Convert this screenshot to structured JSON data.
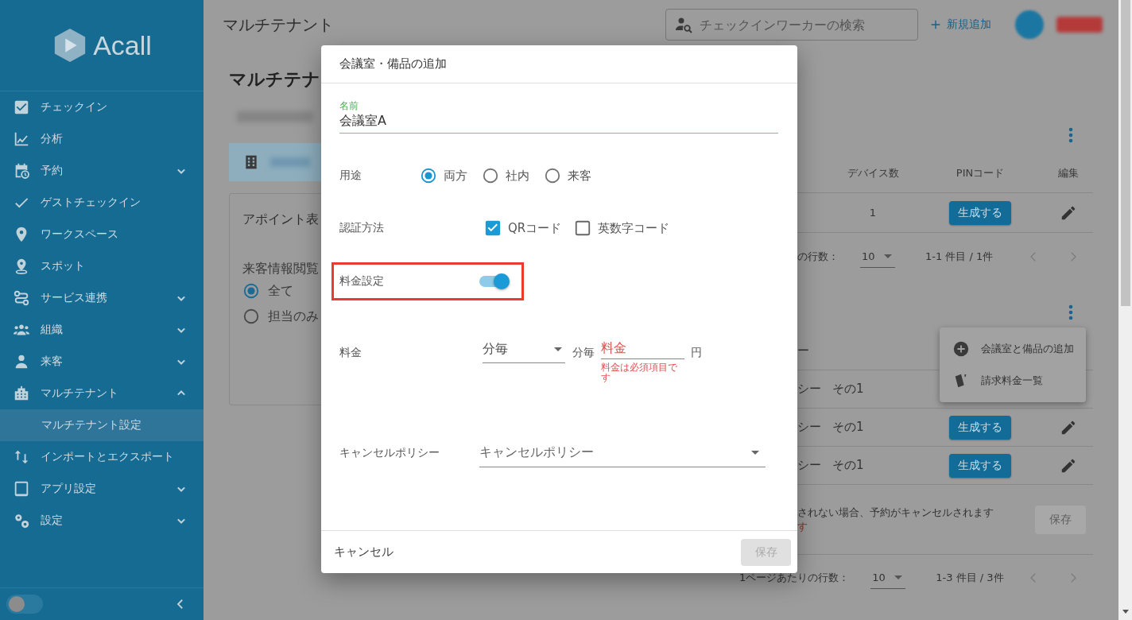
{
  "sidebar": {
    "logo": "Acall",
    "items": [
      {
        "label": "チェックイン",
        "selected": false
      },
      {
        "label": "分析",
        "selected": false
      },
      {
        "label": "予約",
        "selected": false,
        "expanded": false
      },
      {
        "label": "ゲストチェックイン",
        "selected": false
      },
      {
        "label": "ワークスペース",
        "selected": false
      },
      {
        "label": "スポット",
        "selected": false
      },
      {
        "label": "サービス連携",
        "selected": false,
        "expanded": false
      },
      {
        "label": "組織",
        "selected": false,
        "expanded": false
      },
      {
        "label": "来客",
        "selected": false,
        "expanded": false
      },
      {
        "label": "マルチテナント",
        "selected": false,
        "expanded": true,
        "children": [
          {
            "label": "マルチテナント設定",
            "selected": true
          }
        ]
      },
      {
        "label": "インポートとエクスポート",
        "selected": false
      },
      {
        "label": "アプリ設定",
        "selected": false,
        "expanded": false
      },
      {
        "label": "設定",
        "selected": false,
        "expanded": false
      }
    ],
    "footer_toggle": {
      "on": false
    }
  },
  "header": {
    "title": "マルチテナント",
    "search": {
      "placeholder": "チェックインワーカーの検索"
    },
    "add_link": "新規追加"
  },
  "page": {
    "heading": "マルチテナ",
    "appointment_card": {
      "title": "アポイント表",
      "visitor_info_label": "来客情報閲覧",
      "options": [
        {
          "label": "全て",
          "selected": true
        },
        {
          "label": "担当のみ",
          "selected": false
        }
      ]
    },
    "devices_table": {
      "columns": [
        "デバイス数",
        "PINコード",
        "編集"
      ],
      "rows": [
        {
          "device_count": "1",
          "pin_button": "生成する"
        }
      ],
      "pagination": {
        "rows_label": "の行数：",
        "per_page": "10",
        "range": "1-1 件目 / 1件"
      }
    },
    "policy_table": {
      "header_fragment": "ー",
      "rows": [
        {
          "column_1": "シー",
          "column_2": "その1"
        },
        {
          "column_1": "シー",
          "column_2": "その1",
          "pin_button": "生成する"
        },
        {
          "column_1": "シー",
          "column_2": "その1",
          "pin_button": "生成する"
        }
      ],
      "notice": "されない場合、予約がキャンセルされます",
      "notice_error": "す",
      "save_button": {
        "label": "保存",
        "disabled": true
      },
      "pagination": {
        "rows_label": "1ページあたりの行数：",
        "per_page": "10",
        "range": "1-3 件目 / 3件"
      }
    },
    "context_menu": {
      "items": [
        {
          "label": "会議室と備品の追加"
        },
        {
          "label": "請求料金一覧"
        }
      ]
    }
  },
  "dialog": {
    "title": "会議室・備品の追加",
    "name_field": {
      "label": "名前",
      "value": "会議室A"
    },
    "usage": {
      "label": "用途",
      "options": [
        {
          "label": "両方",
          "selected": true
        },
        {
          "label": "社内",
          "selected": false
        },
        {
          "label": "来客",
          "selected": false
        }
      ]
    },
    "auth": {
      "label": "認証方法",
      "options": [
        {
          "label": "QRコード",
          "checked": true
        },
        {
          "label": "英数字コード",
          "checked": false
        }
      ]
    },
    "pricing_toggle": {
      "label": "料金設定",
      "on": true,
      "highlighted": true
    },
    "fee": {
      "label": "料金",
      "unit_select": "分毎",
      "unit_text": "分毎",
      "amount_placeholder": "料金",
      "error": "料金は必須項目です",
      "currency": "円"
    },
    "cancel_policy": {
      "label": "キャンセルポリシー",
      "placeholder": "キャンセルポリシー"
    },
    "cancel_button": "キャンセル",
    "save_button": {
      "label": "保存",
      "disabled": true
    }
  }
}
